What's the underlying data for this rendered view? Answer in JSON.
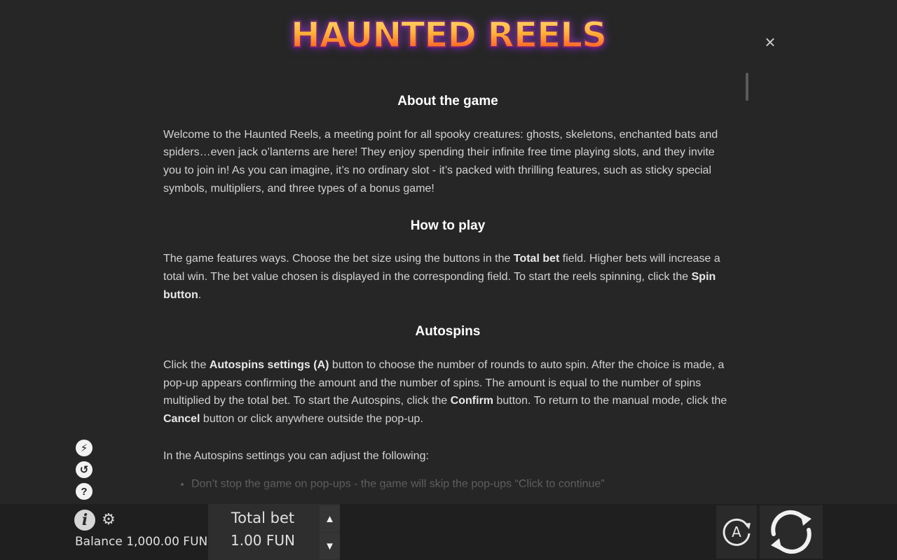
{
  "logo": {
    "text": "HAUNTED REELS"
  },
  "close_label": "×",
  "sections": {
    "about": {
      "title": "About the game",
      "text": "Welcome to the Haunted Reels, a meeting point for all spooky creatures: ghosts, skeletons, enchanted bats and spiders…even jack o’lanterns are here! They enjoy spending their infinite free time playing slots, and they invite you to join in! As you can imagine, it’s no ordinary slot - it’s packed with thrilling features, such as sticky special symbols, multipliers, and three types of a bonus game!"
    },
    "howto": {
      "title": "How to play",
      "p1": "The game features ways. Choose the bet size using the buttons in the ",
      "b1": "Total bet",
      "p2": " field. Higher bets will increase a total win. The bet value chosen is displayed in the corresponding field. To start the reels spinning, click the ",
      "b2": "Spin button",
      "p3": "."
    },
    "autospins": {
      "title": "Autospins",
      "p1": "Click the ",
      "b1": "Autospins settings (A)",
      "p2": " button to choose the number of rounds to auto spin. After the choice is made, a pop-up appears confirming the amount and the number of spins. The amount is equal to the number of spins multiplied by the total bet. To start the Autospins, click the ",
      "b2": "Confirm",
      "p3": " button. To return to the manual mode, click the ",
      "b3": "Cancel",
      "p4": " button or click anywhere outside the pop-up.",
      "settings_intro": "In the Autospins settings you can adjust the following:",
      "bullets": [
        "Don’t stop the game on pop-ups - the game will skip the pop-ups “Click to continue”"
      ]
    }
  },
  "side_icons": [
    {
      "icon": "turbo-icon",
      "glyph": "⚡"
    },
    {
      "icon": "history-icon",
      "glyph": "↺"
    },
    {
      "icon": "help-icon",
      "glyph": "?"
    }
  ],
  "bottom": {
    "info_glyph": "i",
    "gear_glyph": "⚙",
    "balance": "Balance 1,000.00 FUN",
    "total_bet_label": "Total bet",
    "total_bet_value": "1.00 FUN",
    "arrow_up": "▲",
    "arrow_down": "▼",
    "autospin_letter": "A"
  }
}
